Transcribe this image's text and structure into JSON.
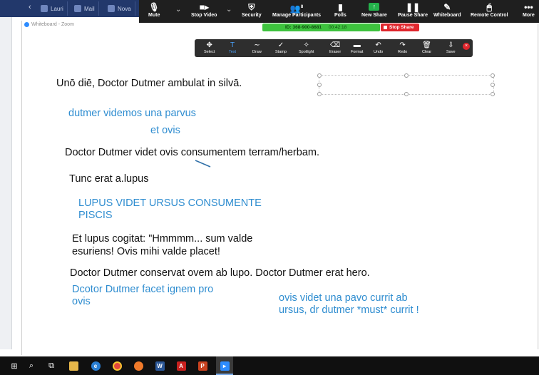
{
  "browser": {
    "tabs": [
      {
        "label": "Lauri"
      },
      {
        "label": "Mail"
      },
      {
        "label": "Nova"
      }
    ]
  },
  "window": {
    "title": "Whiteboard - Zoom"
  },
  "meeting_controls": {
    "buttons": [
      {
        "label": "Mute",
        "icon": "microphone-icon"
      },
      {
        "label": "Stop Video",
        "icon": "video-camera-icon"
      },
      {
        "label": "Security",
        "icon": "shield-icon"
      },
      {
        "label": "Manage Participants",
        "icon": "participants-icon",
        "count": "8"
      },
      {
        "label": "Polls",
        "icon": "polls-icon"
      },
      {
        "label": "New Share",
        "icon": "share-screen-icon"
      },
      {
        "label": "Pause Share",
        "icon": "pause-icon"
      },
      {
        "label": "Whiteboard",
        "icon": "pen-icon"
      },
      {
        "label": "Remote Control",
        "icon": "mouse-icon"
      },
      {
        "label": "More",
        "icon": "more-icon"
      }
    ]
  },
  "meeting_info": {
    "id_text": "ID: 368-900-8681",
    "time": "00:42:18",
    "stop_share": "Stop Share"
  },
  "annotation_toolbar": {
    "tools": [
      {
        "label": "Select",
        "icon": "move-icon"
      },
      {
        "label": "Text",
        "icon": "text-icon",
        "active": true
      },
      {
        "label": "Draw",
        "icon": "squiggle-icon"
      },
      {
        "label": "Stamp",
        "icon": "checkmark-icon"
      },
      {
        "label": "Spotlight",
        "icon": "spotlight-icon"
      },
      {
        "label": "Eraser",
        "icon": "eraser-icon"
      },
      {
        "label": "Format",
        "icon": "format-icon"
      },
      {
        "label": "Undo",
        "icon": "undo-icon"
      },
      {
        "label": "Redo",
        "icon": "redo-icon"
      },
      {
        "label": "Clear",
        "icon": "trash-icon"
      },
      {
        "label": "Save",
        "icon": "save-icon"
      }
    ]
  },
  "whiteboard": {
    "lines": [
      {
        "text": "Unō diē, Doctor Dutmer ambulat in silvā.",
        "color": "black"
      },
      {
        "text": "dutmer videmos una parvus",
        "color": "blue"
      },
      {
        "text": "et ovis",
        "color": "blue"
      },
      {
        "text": "Doctor Dutmer videt ovis consumentem terram/herbam.",
        "color": "black"
      },
      {
        "text": "Tunc erat a.lupus",
        "color": "black"
      },
      {
        "text": "LUPUS VIDET URSUS CONSUMENTE",
        "color": "blue"
      },
      {
        "text": "PISCIS",
        "color": "blue"
      },
      {
        "text": "Et lupus cogitat: \"Hmmmm... sum valde",
        "color": "black"
      },
      {
        "text": "esuriens! Ovis mihi valde placet!",
        "color": "black"
      },
      {
        "text": "Doctor Dutmer conservat ovem ab lupo. Doctor Dutmer erat hero.",
        "color": "black"
      },
      {
        "text": "Dcotor Dutmer facet ignem pro",
        "color": "blue"
      },
      {
        "text": "ovis",
        "color": "blue"
      },
      {
        "text": "ovis videt una pavo currit ab",
        "color": "blue"
      },
      {
        "text": "ursus, dr dutmer *must* currit !",
        "color": "blue"
      }
    ]
  },
  "taskbar": {
    "items": [
      {
        "icon": "windows-start-icon"
      },
      {
        "icon": "search-icon"
      },
      {
        "icon": "task-view-icon"
      },
      {
        "icon": "file-explorer-icon"
      },
      {
        "icon": "edge-browser-icon"
      },
      {
        "icon": "chrome-browser-icon"
      },
      {
        "icon": "firefox-browser-icon"
      },
      {
        "icon": "word-icon"
      },
      {
        "icon": "acrobat-icon"
      },
      {
        "icon": "powerpoint-icon"
      },
      {
        "icon": "zoom-icon"
      }
    ]
  },
  "colors": {
    "handwriting_blue": "#2f8dd0",
    "text_black": "#111111",
    "zoom_green": "#3ec33e",
    "stop_red": "#e0262d"
  }
}
